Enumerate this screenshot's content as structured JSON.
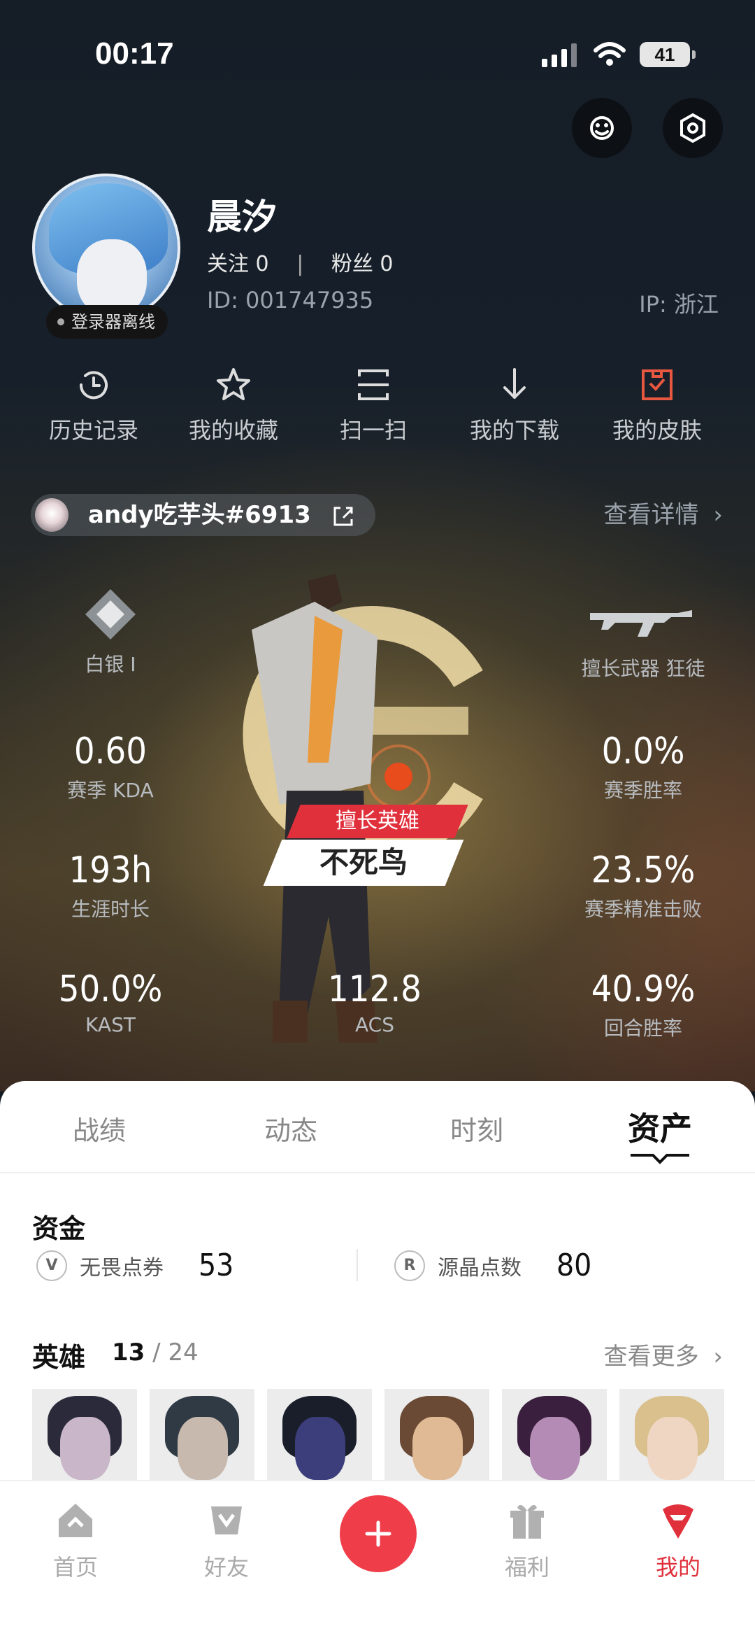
{
  "status_bar": {
    "time": "00:17",
    "battery": "41"
  },
  "profile": {
    "name": "晨汐",
    "follow_label": "关注",
    "follow_count": "0",
    "fans_label": "粉丝",
    "fans_count": "0",
    "id": "ID: 001747935",
    "ip": "IP: 浙江",
    "launcher_status": "登录器离线"
  },
  "quick_actions": [
    {
      "label": "历史记录",
      "icon": "history-clock-icon"
    },
    {
      "label": "我的收藏",
      "icon": "star-icon"
    },
    {
      "label": "扫一扫",
      "icon": "scan-icon"
    },
    {
      "label": "我的下载",
      "icon": "download-icon"
    },
    {
      "label": "我的皮肤",
      "icon": "skin-icon"
    }
  ],
  "game_account": {
    "riot_id": "andy吃芋头#6913",
    "detail_link": "查看详情"
  },
  "stats": {
    "rank": {
      "label": "白银 I"
    },
    "weapon": {
      "label": "擅长武器 狂徒"
    },
    "kda": {
      "value": "0.60",
      "label": "赛季 KDA"
    },
    "win_rate": {
      "value": "0.0%",
      "label": "赛季胜率"
    },
    "playtime": {
      "value": "193h",
      "label": "生涯时长"
    },
    "precise_kill": {
      "value": "23.5%",
      "label": "赛季精准击败"
    },
    "kast": {
      "value": "50.0%",
      "label": "KAST"
    },
    "acs": {
      "value": "112.8",
      "label": "ACS"
    },
    "round_win": {
      "value": "40.9%",
      "label": "回合胜率"
    }
  },
  "best_agent": {
    "tag": "擅长英雄",
    "name": "不死鸟"
  },
  "tabs": [
    {
      "label": "战绩",
      "active": false
    },
    {
      "label": "动态",
      "active": false
    },
    {
      "label": "时刻",
      "active": false
    },
    {
      "label": "资产",
      "active": true
    }
  ],
  "funds": {
    "title": "资金",
    "vp_label": "无畏点券",
    "vp_value": "53",
    "radianite_label": "源晶点数",
    "radianite_value": "80"
  },
  "heroes": {
    "title": "英雄",
    "owned": "13",
    "total": "/ 24",
    "more": "查看更多"
  },
  "bottom_nav": [
    {
      "label": "首页",
      "icon": "home-icon"
    },
    {
      "label": "好友",
      "icon": "friends-icon"
    },
    {
      "label": "福利",
      "icon": "gift-icon"
    },
    {
      "label": "我的",
      "icon": "profile-icon"
    }
  ],
  "colors": {
    "accent": "#e0303c",
    "dark_bg": "#17202a",
    "sheet_bg": "#ffffff"
  }
}
